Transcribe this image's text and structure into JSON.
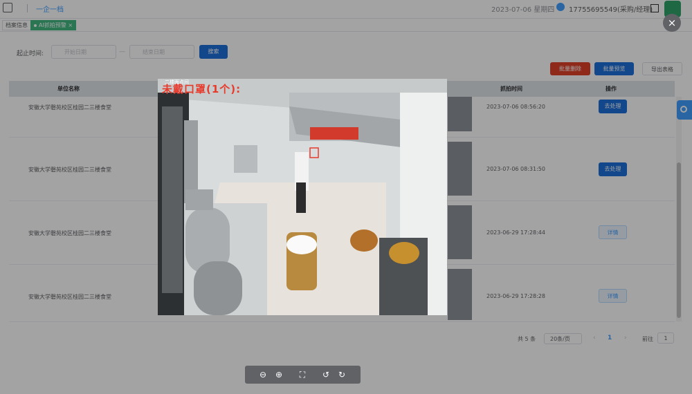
{
  "header": {
    "breadcrumb": "一企一档",
    "date": "2023-07-06 星期四",
    "user": "17755695549(采购/经理)"
  },
  "tabs": [
    {
      "label": "档案信息",
      "active": false
    },
    {
      "label": "AI抓拍预警",
      "active": true,
      "close": "×"
    }
  ],
  "filter": {
    "label": "起止时间:",
    "start_placeholder": "开始日期",
    "end_placeholder": "结束日期",
    "separator": "—",
    "search_label": "搜索"
  },
  "actions": {
    "batch_delete": "批量删除",
    "batch_preview": "批量预览",
    "export": "导出表格"
  },
  "table": {
    "columns": [
      "单位名称",
      "抓拍时间",
      "操作"
    ],
    "rows": [
      {
        "unit": "安徽大学磬苑校区桂园二三楼食堂",
        "time": "2023-07-06 08:56:20",
        "action": "去处理"
      },
      {
        "unit": "安徽大学磬苑校区桂园二三楼食堂",
        "time": "2023-07-06 08:31:50",
        "action": "去处理"
      },
      {
        "unit": "安徽大学磬苑校区桂园二三楼食堂",
        "time": "2023-06-29 17:28:44",
        "action": "详情"
      },
      {
        "unit": "安徽大学磬苑校区桂园二三楼食堂",
        "time": "2023-06-29 17:28:28",
        "action": "详情"
      }
    ]
  },
  "pagination": {
    "total": "共 5 条",
    "page_size": "20条/页",
    "prev": "‹",
    "current": "1",
    "next": "›",
    "goto_label": "前往",
    "goto_value": "1"
  },
  "viewer": {
    "camera_label": "二楼面点间",
    "overlay_text": "未戴口罩(1个):",
    "close": "×"
  },
  "colors": {
    "primary": "#1e6fd9",
    "danger": "#e0432b",
    "active_tab": "#42b983",
    "detection_box": "#e83a2b"
  },
  "icons": [
    "menu-icon",
    "phone-icon",
    "fullscreen-icon",
    "avatar",
    "calendar-icon",
    "settings-icon",
    "zoom-out-icon",
    "zoom-in-icon",
    "fit-screen-icon",
    "rotate-left-icon",
    "rotate-right-icon",
    "close-icon"
  ]
}
